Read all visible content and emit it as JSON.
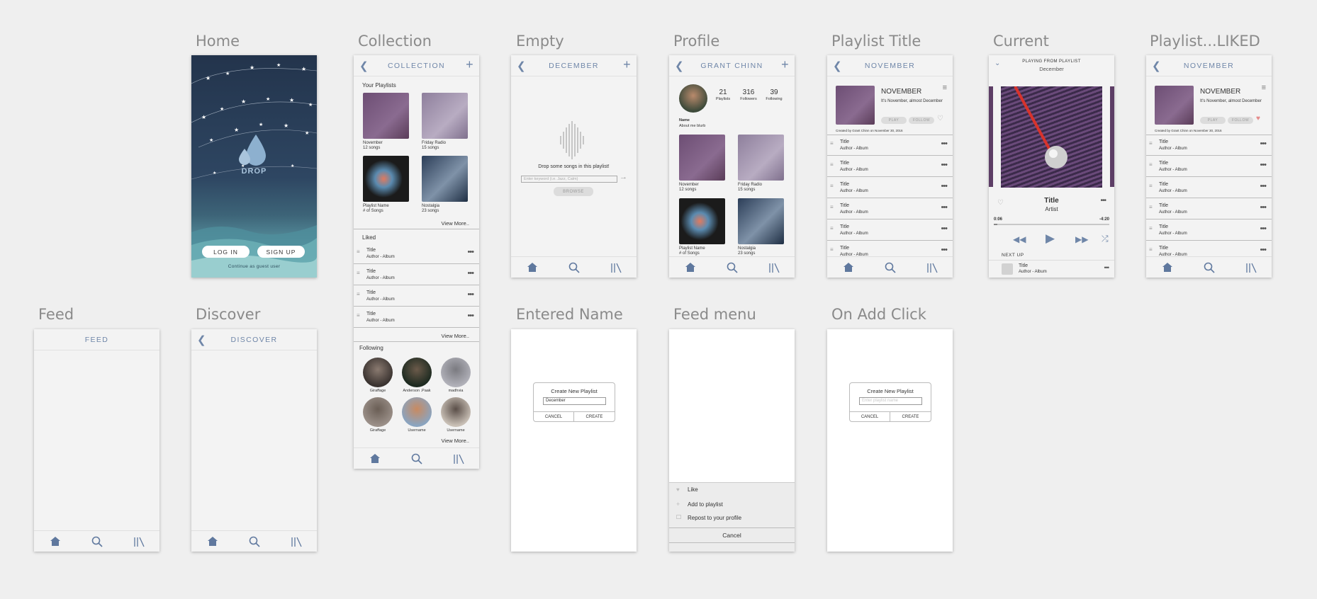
{
  "screens": {
    "home": {
      "label": "Home",
      "logo": "DROP",
      "login": "LOG IN",
      "signup": "SIGN UP",
      "guest": "Continue as guest user"
    },
    "collection": {
      "label": "Collection",
      "header": "COLLECTION",
      "your_playlists": "Your Playlists",
      "playlists": [
        {
          "name": "November",
          "sub": "12 songs"
        },
        {
          "name": "Friday Radio",
          "sub": "15 songs"
        },
        {
          "name": "Playlist Name",
          "sub": "# of Songs"
        },
        {
          "name": "Nostalgia",
          "sub": "23 songs"
        }
      ],
      "view_more_1": "View More..",
      "liked": "Liked",
      "liked_rows": [
        {
          "title": "Title",
          "sub": "Author - Album"
        },
        {
          "title": "Title",
          "sub": "Author - Album"
        },
        {
          "title": "Title",
          "sub": "Author - Album"
        },
        {
          "title": "Title",
          "sub": "Author - Album"
        }
      ],
      "view_more_2": "View More..",
      "following": "Following",
      "users": [
        "Giraffage",
        "Anderson .Paak",
        "madhvia",
        "Giraffage",
        "Username",
        "Username"
      ],
      "view_more_3": "View More.."
    },
    "empty": {
      "label": "Empty",
      "header": "DECEMBER",
      "drop_text": "Drop some songs in this playlist!",
      "placeholder": "Enter keyword (i.e. Jazz, Calm)",
      "browse": "BROWSE"
    },
    "profile": {
      "label": "Profile",
      "header": "GRANT CHINN",
      "stats": [
        {
          "n": "21",
          "l": "Playlists"
        },
        {
          "n": "316",
          "l": "Followers"
        },
        {
          "n": "39",
          "l": "Following"
        }
      ],
      "name": "Name",
      "about": "About me blurb",
      "playlists": [
        {
          "name": "November",
          "sub": "12 songs"
        },
        {
          "name": "Friday Radio",
          "sub": "15 songs"
        },
        {
          "name": "Playlist Name",
          "sub": "# of Songs"
        },
        {
          "name": "Nostalgia",
          "sub": "23 songs"
        }
      ]
    },
    "playlist_title": {
      "label": "Playlist Title",
      "header": "NOVEMBER",
      "title": "NOVEMBER",
      "desc": "It's November, almost December",
      "play": "PLAY",
      "follow": "FOLLOW",
      "created": "Created by Grant Chinn on November 30, 2016",
      "rows": [
        {
          "title": "Title",
          "sub": "Author - Album"
        },
        {
          "title": "Title",
          "sub": "Author - Album"
        },
        {
          "title": "Title",
          "sub": "Author - Album"
        },
        {
          "title": "Title",
          "sub": "Author - Album"
        },
        {
          "title": "Title",
          "sub": "Author - Album"
        },
        {
          "title": "Title",
          "sub": "Author - Album"
        }
      ]
    },
    "current": {
      "label": "Current",
      "playing_from": "PLAYING FROM PLAYLIST",
      "playlist": "December",
      "track": "Title",
      "artist": "Artist",
      "elapsed": "0:06",
      "remaining": "-4:20",
      "progress": 0.03,
      "next_up": "NEXT UP",
      "next_title": "Title",
      "next_sub": "Author - Album"
    },
    "playlist_liked": {
      "label": "Playlist...LIKED",
      "header": "NOVEMBER",
      "title": "NOVEMBER",
      "desc": "It's November, almost December",
      "play": "PLAY",
      "follow": "FOLLOW",
      "created": "Created by Grant Chinn on November 30, 2016",
      "rows": [
        {
          "title": "Title",
          "sub": "Author - Album"
        },
        {
          "title": "Title",
          "sub": "Author - Album"
        },
        {
          "title": "Title",
          "sub": "Author - Album"
        },
        {
          "title": "Title",
          "sub": "Author - Album"
        },
        {
          "title": "Title",
          "sub": "Author - Album"
        },
        {
          "title": "Title",
          "sub": "Author - Album"
        }
      ]
    },
    "feed": {
      "label": "Feed",
      "header": "FEED"
    },
    "discover": {
      "label": "Discover",
      "header": "DISCOVER"
    },
    "entered_name": {
      "label": "Entered Name",
      "title": "Create New Playlist",
      "value": "December",
      "cancel": "CANCEL",
      "create": "CREATE"
    },
    "feed_menu": {
      "label": "Feed menu",
      "items": [
        "Like",
        "Add to playlist",
        "Repost to your profile"
      ],
      "cancel": "Cancel"
    },
    "on_add_click": {
      "label": "On Add Click",
      "title": "Create New Playlist",
      "placeholder": "Enter playlist name",
      "cancel": "CANCEL",
      "create": "CREATE"
    }
  },
  "colors": {
    "accent": "#6f86a8",
    "liked_heart": "#e58a8a",
    "background": "#efefef"
  }
}
